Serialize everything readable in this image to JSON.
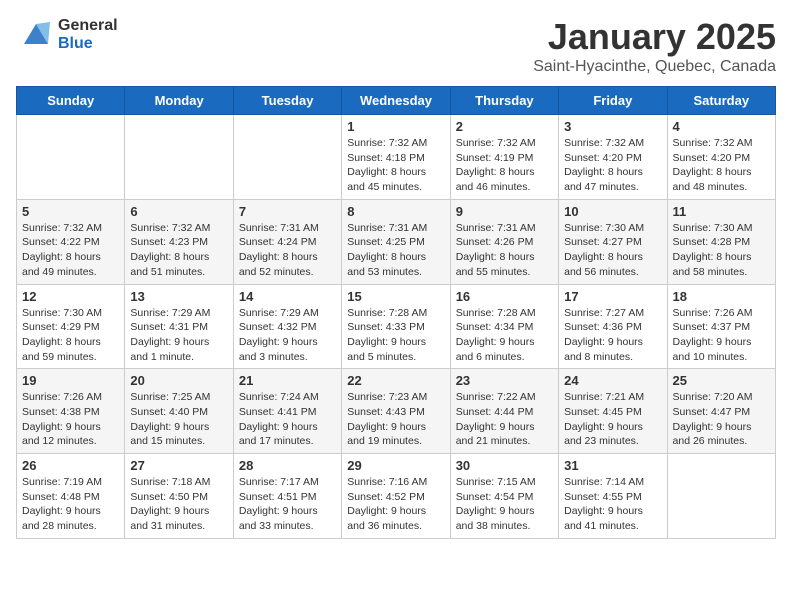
{
  "header": {
    "logo_general": "General",
    "logo_blue": "Blue",
    "month_title": "January 2025",
    "location": "Saint-Hyacinthe, Quebec, Canada"
  },
  "days_of_week": [
    "Sunday",
    "Monday",
    "Tuesday",
    "Wednesday",
    "Thursday",
    "Friday",
    "Saturday"
  ],
  "weeks": [
    [
      {
        "day": "",
        "sunrise": "",
        "sunset": "",
        "daylight": ""
      },
      {
        "day": "",
        "sunrise": "",
        "sunset": "",
        "daylight": ""
      },
      {
        "day": "",
        "sunrise": "",
        "sunset": "",
        "daylight": ""
      },
      {
        "day": "1",
        "sunrise": "Sunrise: 7:32 AM",
        "sunset": "Sunset: 4:18 PM",
        "daylight": "Daylight: 8 hours and 45 minutes."
      },
      {
        "day": "2",
        "sunrise": "Sunrise: 7:32 AM",
        "sunset": "Sunset: 4:19 PM",
        "daylight": "Daylight: 8 hours and 46 minutes."
      },
      {
        "day": "3",
        "sunrise": "Sunrise: 7:32 AM",
        "sunset": "Sunset: 4:20 PM",
        "daylight": "Daylight: 8 hours and 47 minutes."
      },
      {
        "day": "4",
        "sunrise": "Sunrise: 7:32 AM",
        "sunset": "Sunset: 4:20 PM",
        "daylight": "Daylight: 8 hours and 48 minutes."
      }
    ],
    [
      {
        "day": "5",
        "sunrise": "Sunrise: 7:32 AM",
        "sunset": "Sunset: 4:22 PM",
        "daylight": "Daylight: 8 hours and 49 minutes."
      },
      {
        "day": "6",
        "sunrise": "Sunrise: 7:32 AM",
        "sunset": "Sunset: 4:23 PM",
        "daylight": "Daylight: 8 hours and 51 minutes."
      },
      {
        "day": "7",
        "sunrise": "Sunrise: 7:31 AM",
        "sunset": "Sunset: 4:24 PM",
        "daylight": "Daylight: 8 hours and 52 minutes."
      },
      {
        "day": "8",
        "sunrise": "Sunrise: 7:31 AM",
        "sunset": "Sunset: 4:25 PM",
        "daylight": "Daylight: 8 hours and 53 minutes."
      },
      {
        "day": "9",
        "sunrise": "Sunrise: 7:31 AM",
        "sunset": "Sunset: 4:26 PM",
        "daylight": "Daylight: 8 hours and 55 minutes."
      },
      {
        "day": "10",
        "sunrise": "Sunrise: 7:30 AM",
        "sunset": "Sunset: 4:27 PM",
        "daylight": "Daylight: 8 hours and 56 minutes."
      },
      {
        "day": "11",
        "sunrise": "Sunrise: 7:30 AM",
        "sunset": "Sunset: 4:28 PM",
        "daylight": "Daylight: 8 hours and 58 minutes."
      }
    ],
    [
      {
        "day": "12",
        "sunrise": "Sunrise: 7:30 AM",
        "sunset": "Sunset: 4:29 PM",
        "daylight": "Daylight: 8 hours and 59 minutes."
      },
      {
        "day": "13",
        "sunrise": "Sunrise: 7:29 AM",
        "sunset": "Sunset: 4:31 PM",
        "daylight": "Daylight: 9 hours and 1 minute."
      },
      {
        "day": "14",
        "sunrise": "Sunrise: 7:29 AM",
        "sunset": "Sunset: 4:32 PM",
        "daylight": "Daylight: 9 hours and 3 minutes."
      },
      {
        "day": "15",
        "sunrise": "Sunrise: 7:28 AM",
        "sunset": "Sunset: 4:33 PM",
        "daylight": "Daylight: 9 hours and 5 minutes."
      },
      {
        "day": "16",
        "sunrise": "Sunrise: 7:28 AM",
        "sunset": "Sunset: 4:34 PM",
        "daylight": "Daylight: 9 hours and 6 minutes."
      },
      {
        "day": "17",
        "sunrise": "Sunrise: 7:27 AM",
        "sunset": "Sunset: 4:36 PM",
        "daylight": "Daylight: 9 hours and 8 minutes."
      },
      {
        "day": "18",
        "sunrise": "Sunrise: 7:26 AM",
        "sunset": "Sunset: 4:37 PM",
        "daylight": "Daylight: 9 hours and 10 minutes."
      }
    ],
    [
      {
        "day": "19",
        "sunrise": "Sunrise: 7:26 AM",
        "sunset": "Sunset: 4:38 PM",
        "daylight": "Daylight: 9 hours and 12 minutes."
      },
      {
        "day": "20",
        "sunrise": "Sunrise: 7:25 AM",
        "sunset": "Sunset: 4:40 PM",
        "daylight": "Daylight: 9 hours and 15 minutes."
      },
      {
        "day": "21",
        "sunrise": "Sunrise: 7:24 AM",
        "sunset": "Sunset: 4:41 PM",
        "daylight": "Daylight: 9 hours and 17 minutes."
      },
      {
        "day": "22",
        "sunrise": "Sunrise: 7:23 AM",
        "sunset": "Sunset: 4:43 PM",
        "daylight": "Daylight: 9 hours and 19 minutes."
      },
      {
        "day": "23",
        "sunrise": "Sunrise: 7:22 AM",
        "sunset": "Sunset: 4:44 PM",
        "daylight": "Daylight: 9 hours and 21 minutes."
      },
      {
        "day": "24",
        "sunrise": "Sunrise: 7:21 AM",
        "sunset": "Sunset: 4:45 PM",
        "daylight": "Daylight: 9 hours and 23 minutes."
      },
      {
        "day": "25",
        "sunrise": "Sunrise: 7:20 AM",
        "sunset": "Sunset: 4:47 PM",
        "daylight": "Daylight: 9 hours and 26 minutes."
      }
    ],
    [
      {
        "day": "26",
        "sunrise": "Sunrise: 7:19 AM",
        "sunset": "Sunset: 4:48 PM",
        "daylight": "Daylight: 9 hours and 28 minutes."
      },
      {
        "day": "27",
        "sunrise": "Sunrise: 7:18 AM",
        "sunset": "Sunset: 4:50 PM",
        "daylight": "Daylight: 9 hours and 31 minutes."
      },
      {
        "day": "28",
        "sunrise": "Sunrise: 7:17 AM",
        "sunset": "Sunset: 4:51 PM",
        "daylight": "Daylight: 9 hours and 33 minutes."
      },
      {
        "day": "29",
        "sunrise": "Sunrise: 7:16 AM",
        "sunset": "Sunset: 4:52 PM",
        "daylight": "Daylight: 9 hours and 36 minutes."
      },
      {
        "day": "30",
        "sunrise": "Sunrise: 7:15 AM",
        "sunset": "Sunset: 4:54 PM",
        "daylight": "Daylight: 9 hours and 38 minutes."
      },
      {
        "day": "31",
        "sunrise": "Sunrise: 7:14 AM",
        "sunset": "Sunset: 4:55 PM",
        "daylight": "Daylight: 9 hours and 41 minutes."
      },
      {
        "day": "",
        "sunrise": "",
        "sunset": "",
        "daylight": ""
      }
    ]
  ]
}
